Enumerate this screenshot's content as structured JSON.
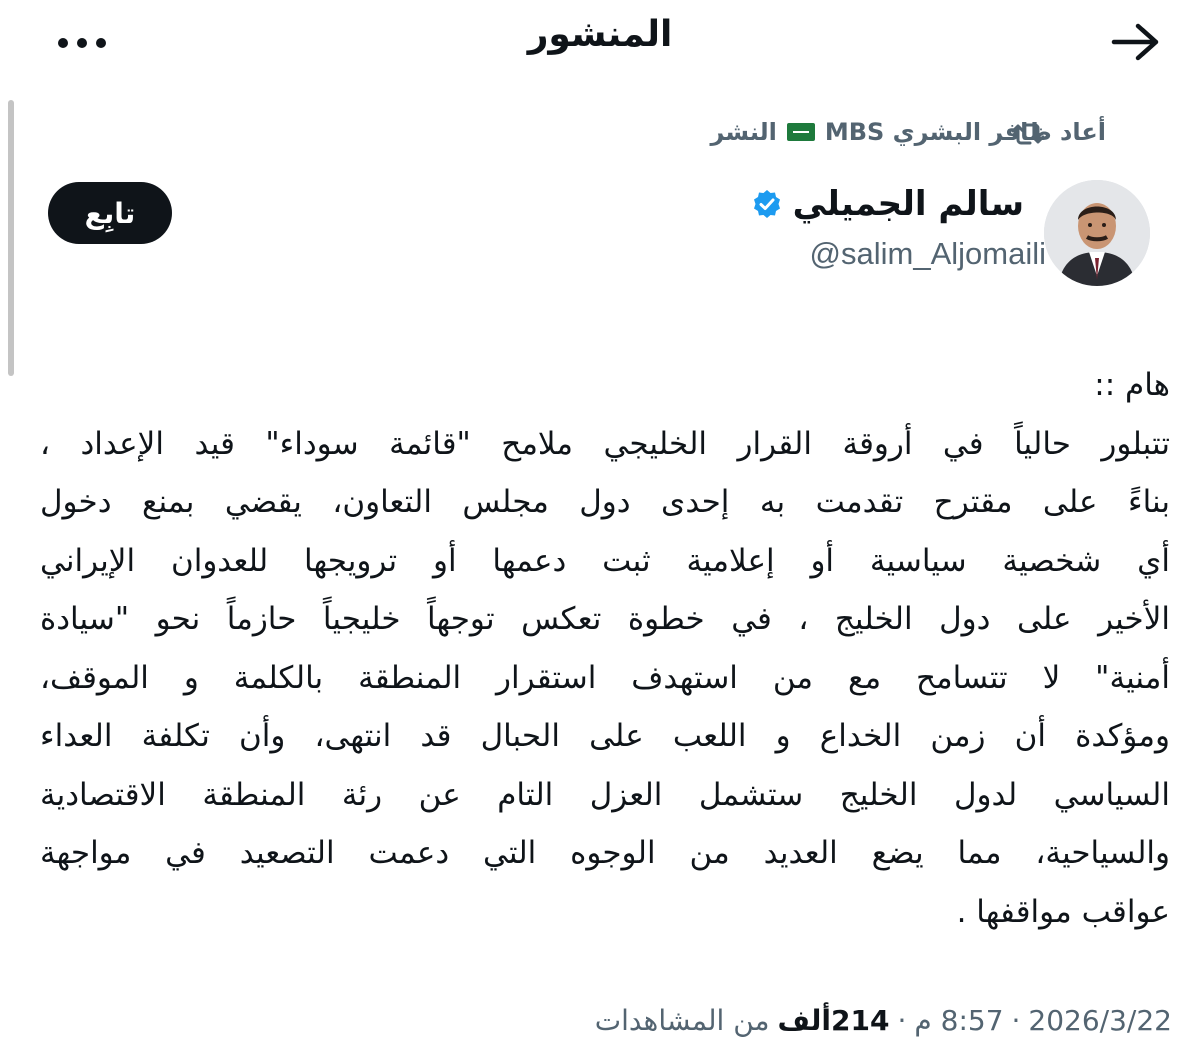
{
  "header": {
    "title": "المنشور",
    "back_icon": "arrow-right-icon",
    "more_icon": "more-horizontal-icon"
  },
  "repost": {
    "icon": "repost-icon",
    "reposter": "أعاد ظافر البشري MBS",
    "flag": "saudi-flag-icon",
    "suffix": "النشر"
  },
  "author": {
    "name": "سالم الجميلي",
    "handle": "@salim_Aljomaili",
    "verified_color": "#1d9bf0"
  },
  "follow_label": "تابِع",
  "post": {
    "lines": [
      "هام ::",
      "تتبلور حالياً في أروقة القرار الخليجي ملامح \"قائمة سوداء\" قيد الإعداد ،",
      "بناءً على مقترح تقدمت به إحدى دول مجلس التعاون، يقضي بمنع دخول",
      "أي شخصية سياسية أو إعلامية ثبت دعمها أو ترويجها للعدوان الإيراني",
      "الأخير على دول الخليج ، في خطوة تعكس توجهاً خليجياً حازماً نحو \"سيادة",
      "أمنية\" لا تتسامح مع من استهدف استقرار المنطقة بالكلمة و الموقف،",
      "ومؤكدة أن زمن الخداع و اللعب على الحبال قد انتهى، وأن تكلفة العداء",
      "السياسي لدول الخليج ستشمل العزل التام عن رئة المنطقة الاقتصادية",
      "والسياحية، مما يضع العديد من الوجوه التي دعمت التصعيد في مواجهة",
      "عواقب مواقفها ."
    ]
  },
  "meta": {
    "date": "2026/3/22",
    "separator": "·",
    "time": "8:57 م",
    "views_count": "214",
    "views_unit": "ألف",
    "views_label": "من المشاهدات"
  },
  "colors": {
    "text": "#0f1419",
    "secondary": "#536471",
    "verified": "#1d9bf0",
    "follow_bg": "#0f1419"
  }
}
